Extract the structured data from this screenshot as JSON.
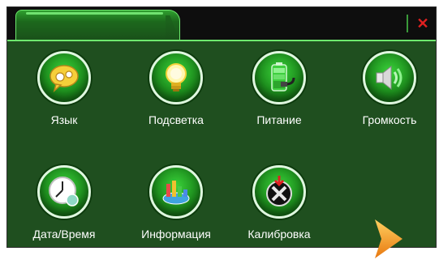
{
  "window": {
    "close_glyph": "✕"
  },
  "menu": {
    "items": [
      {
        "label": "Язык",
        "icon": "language-icon"
      },
      {
        "label": "Подсветка",
        "icon": "backlight-icon"
      },
      {
        "label": "Питание",
        "icon": "power-icon"
      },
      {
        "label": "Громкость",
        "icon": "volume-icon"
      },
      {
        "label": "Дата/Время",
        "icon": "clock-icon"
      },
      {
        "label": "Информация",
        "icon": "info-chart-icon"
      },
      {
        "label": "Калибровка",
        "icon": "calibration-icon"
      }
    ],
    "next_page_icon": "arrow-right-icon"
  },
  "colors": {
    "panel": "#1f4f1f",
    "accent": "#6ee86e",
    "close": "#e02020",
    "arrow": "#f5a020"
  }
}
